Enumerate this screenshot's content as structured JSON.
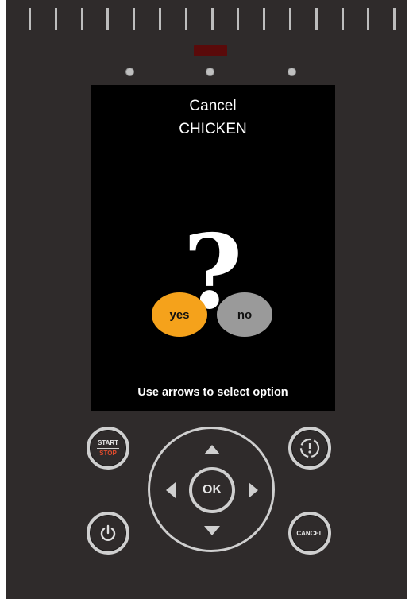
{
  "screen": {
    "title": "Cancel",
    "program": "CHICKEN",
    "prompt_symbol": "?",
    "options": {
      "yes": "yes",
      "no": "no"
    },
    "selected_option": "yes",
    "hint": "Use arrows to select option"
  },
  "controls": {
    "start_label": "START",
    "stop_label": "STOP",
    "ok_label": "OK",
    "cancel_label": "CANCEL"
  },
  "colors": {
    "panel": "#2f2b2b",
    "screen": "#000000",
    "selected_option": "#f5a21b",
    "unselected_option": "#9a9a9a",
    "stop_text": "#e14b2c",
    "status_led": "#5a0a0a"
  },
  "icons": {
    "power": "power-icon",
    "refresh": "refresh-cycle-icon",
    "up": "arrow-up-icon",
    "down": "arrow-down-icon",
    "left": "arrow-left-icon",
    "right": "arrow-right-icon"
  }
}
